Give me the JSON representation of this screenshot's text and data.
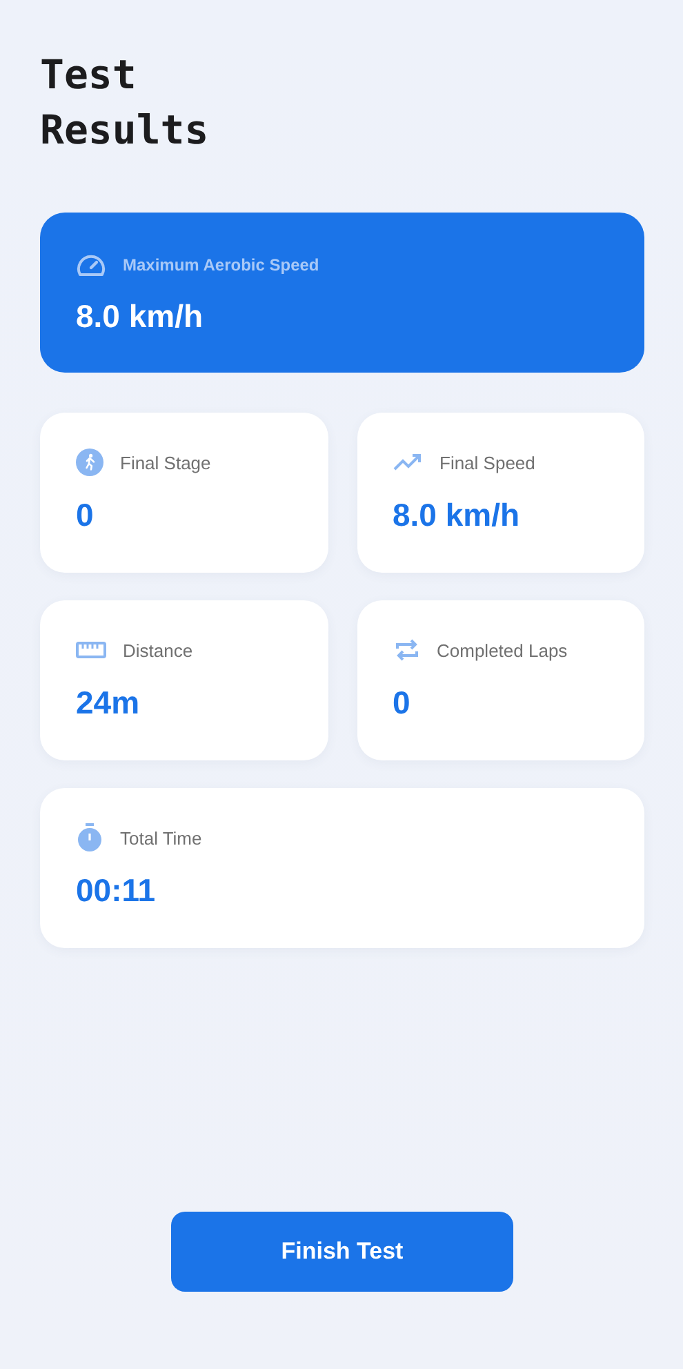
{
  "title": "Test Results",
  "highlight": {
    "label": "Maximum Aerobic Speed",
    "value": "8.0 km/h"
  },
  "stats": [
    {
      "label": "Final Stage",
      "value": "0"
    },
    {
      "label": "Final Speed",
      "value": "8.0 km/h"
    },
    {
      "label": "Distance",
      "value": "24m"
    },
    {
      "label": "Completed Laps",
      "value": "0"
    },
    {
      "label": "Total Time",
      "value": "00:11"
    }
  ],
  "button": "Finish Test"
}
